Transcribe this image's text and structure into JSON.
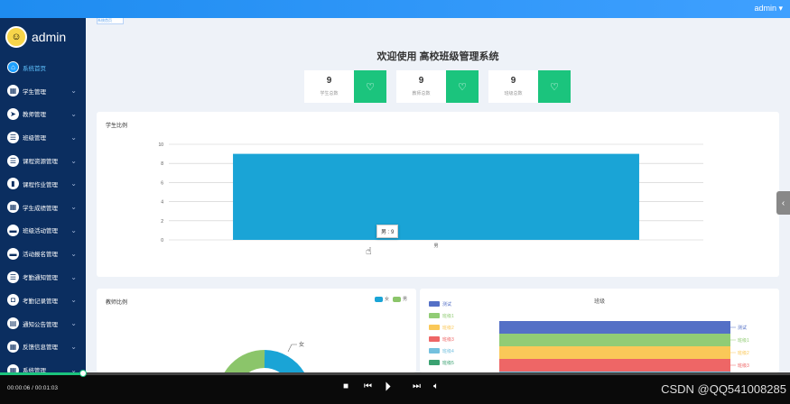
{
  "topbar": {
    "user": "admin ▾"
  },
  "sidebar": {
    "admin_name": "admin",
    "items": [
      {
        "label": "系统首页",
        "icon": "home-icon",
        "glyph": "⌂",
        "active": true
      },
      {
        "label": "学生管理",
        "icon": "grid-icon",
        "glyph": "▦"
      },
      {
        "label": "教师管理",
        "icon": "send-icon",
        "glyph": "➤"
      },
      {
        "label": "班级管理",
        "icon": "list-icon",
        "glyph": "☰"
      },
      {
        "label": "课程资源管理",
        "icon": "menu-icon",
        "glyph": "☰"
      },
      {
        "label": "课程作业管理",
        "icon": "book-icon",
        "glyph": "▮"
      },
      {
        "label": "学生成绩管理",
        "icon": "grid-icon",
        "glyph": "▦"
      },
      {
        "label": "班级活动管理",
        "icon": "card-icon",
        "glyph": "▬"
      },
      {
        "label": "活动报名管理",
        "icon": "card-icon",
        "glyph": "▬"
      },
      {
        "label": "考勤通知管理",
        "icon": "list-icon",
        "glyph": "☰"
      },
      {
        "label": "考勤记录管理",
        "icon": "lock-icon",
        "glyph": "◘"
      },
      {
        "label": "通知公告管理",
        "icon": "doc-icon",
        "glyph": "▤"
      },
      {
        "label": "反馈信息管理",
        "icon": "grid-icon",
        "glyph": "▦"
      },
      {
        "label": "系统管理",
        "icon": "grid-icon",
        "glyph": "▦"
      }
    ]
  },
  "breadcrumb": "系统首页",
  "welcome": "欢迎使用 高校班级管理系统",
  "stats": [
    {
      "value": "9",
      "caption": "学生总数"
    },
    {
      "value": "9",
      "caption": "教师总数"
    },
    {
      "value": "9",
      "caption": "班级总数"
    }
  ],
  "student_chart": {
    "title": "学生比例",
    "tooltip": "男 : 9",
    "x_tick_label": "男"
  },
  "teacher_chart": {
    "title": "教师比例",
    "legend": [
      "女",
      "男"
    ],
    "slice_label": "女"
  },
  "class_chart": {
    "title": "班级"
  },
  "chart_data": [
    {
      "type": "bar",
      "title": "学生比例",
      "categories": [
        "男"
      ],
      "values": [
        9
      ],
      "ylim": [
        0,
        10
      ],
      "yticks": [
        0,
        2,
        4,
        6,
        8,
        10
      ],
      "color": "#1aa4d6",
      "grid": true
    },
    {
      "type": "pie",
      "title": "教师比例",
      "legend": [
        "女",
        "男"
      ],
      "colors": [
        "#1aa4d6",
        "#8bc56a"
      ],
      "legend_position": "top-right"
    },
    {
      "type": "bar",
      "title": "班级",
      "categories": [
        "测试",
        "班级1",
        "班级2",
        "班级3",
        "班级4",
        "班级5"
      ],
      "colors": [
        "#5470c6",
        "#91cc75",
        "#fac858",
        "#ee6666",
        "#73c0de",
        "#3ba272"
      ],
      "legend_position": "left"
    }
  ],
  "video": {
    "time": "00:00:06 / 00:01:03",
    "progress": 0.105,
    "watermark": "CSDN @QQ541008285"
  },
  "colors": {
    "sidebar": "#0b2e60",
    "accent": "#1e8cf0",
    "stat_green": "#1bc47d"
  }
}
